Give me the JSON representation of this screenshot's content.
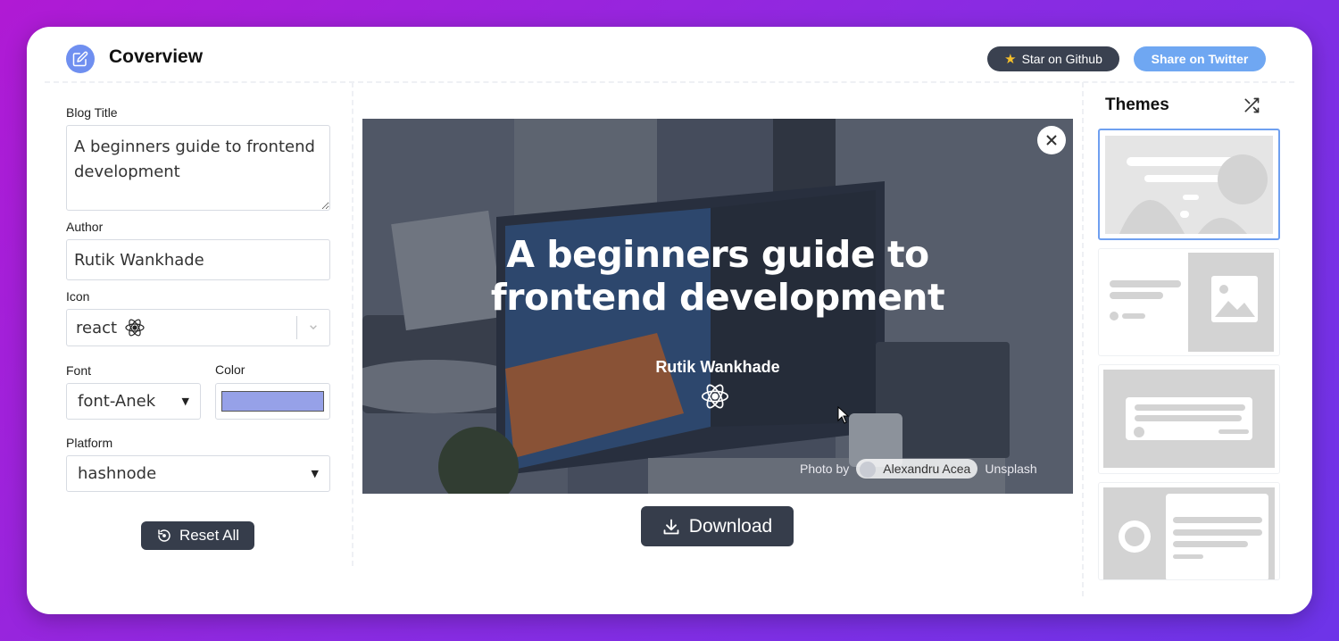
{
  "header": {
    "brand": "Coverview",
    "github_label": "Star on Github",
    "twitter_label": "Share on Twitter"
  },
  "form": {
    "blog_title_label": "Blog Title",
    "blog_title_value": "A beginners guide to frontend development",
    "author_label": "Author",
    "author_value": "Rutik Wankhade",
    "icon_label": "Icon",
    "icon_value": "react",
    "font_label": "Font",
    "font_value": "font-Anek",
    "color_label": "Color",
    "color_value": "#96a1e8",
    "platform_label": "Platform",
    "platform_value": "hashnode",
    "reset_label": "Reset All"
  },
  "preview": {
    "title": "A beginners guide to frontend development",
    "author": "Rutik Wankhade",
    "photo_by": "Photo by",
    "photographer": "Alexandru Acea",
    "source": "Unsplash"
  },
  "download_label": "Download",
  "themes": {
    "title": "Themes"
  },
  "colors": {
    "accent": "#6fa7f2",
    "dark_button": "#363d4b",
    "logo": "#6f8ff0"
  }
}
